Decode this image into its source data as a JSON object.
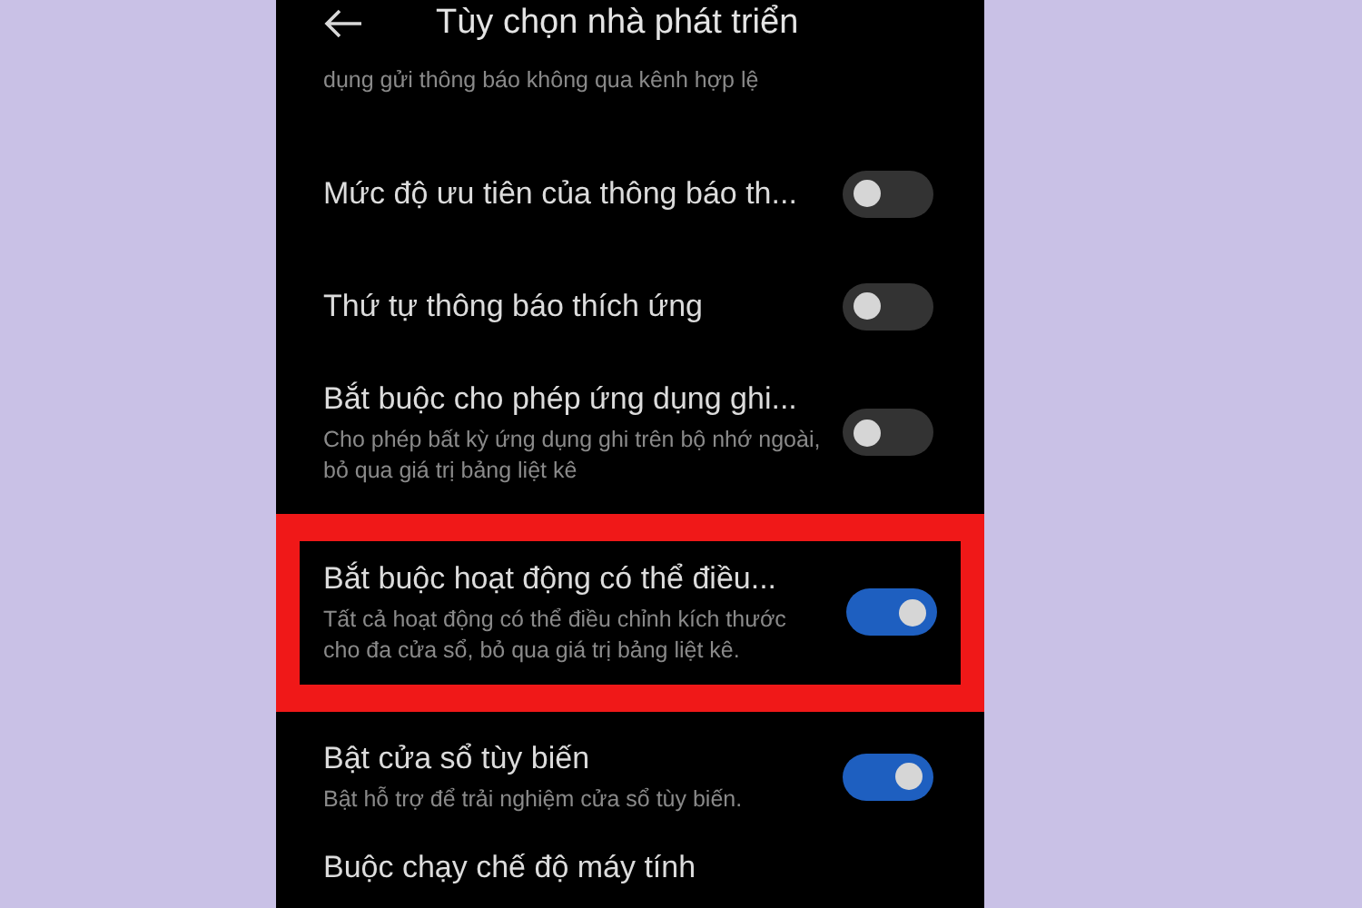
{
  "header": {
    "title": "Tùy chọn nhà phát triển"
  },
  "continued_text": "dụng gửi thông báo không qua kênh hợp lệ",
  "settings": [
    {
      "title": "Mức độ ưu tiên của thông báo th...",
      "on": false,
      "highlighted": false
    },
    {
      "title": "Thứ tự thông báo thích ứng",
      "on": false,
      "highlighted": false
    },
    {
      "title": "Bắt buộc cho phép ứng dụng ghi...",
      "description": "Cho phép bất kỳ ứng dụng ghi trên bộ nhớ ngoài, bỏ qua giá trị bảng liệt kê",
      "on": false,
      "highlighted": false
    },
    {
      "title": "Bắt buộc hoạt động có thể điều...",
      "description": "Tất cả hoạt động có thể điều chỉnh kích thước cho đa cửa sổ, bỏ qua giá trị bảng liệt kê.",
      "on": true,
      "highlighted": true
    },
    {
      "title": "Bật cửa sổ tùy biến",
      "description": "Bật hỗ trợ để trải nghiệm cửa sổ tùy biến.",
      "on": true,
      "highlighted": false
    },
    {
      "title": "Buộc chạy chế độ máy tính",
      "highlighted": false
    }
  ]
}
